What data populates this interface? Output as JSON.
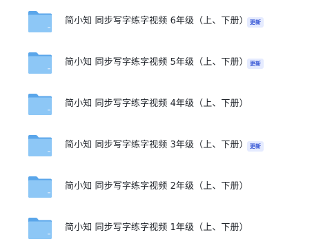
{
  "folders": [
    {
      "name": "简小知 同步写字练字视频 6年级（上、下册）",
      "badge": "更新",
      "icon": "folder-icon"
    },
    {
      "name": "简小知 同步写字练字视频 5年级（上、下册）",
      "badge": "更新",
      "icon": "folder-icon"
    },
    {
      "name": "简小知 同步写字练字视频 4年级（上、下册）",
      "badge": "",
      "icon": "folder-icon"
    },
    {
      "name": "简小知 同步写字练字视频 3年级（上、下册）",
      "badge": "更新",
      "icon": "folder-icon"
    },
    {
      "name": "简小知 同步写字练字视频 2年级（上、下册）",
      "badge": "",
      "icon": "folder-icon"
    },
    {
      "name": "简小知 同步写字练字视频 1年级（上、下册）",
      "badge": "",
      "icon": "folder-icon"
    }
  ],
  "colors": {
    "folder_back": "#6fb3ef",
    "folder_front": "#8dc7f6",
    "folder_tab": "#5aa6ea",
    "text": "#1f2329",
    "badge_bg": "#e5ebff",
    "badge_text": "#3c5bd6"
  }
}
